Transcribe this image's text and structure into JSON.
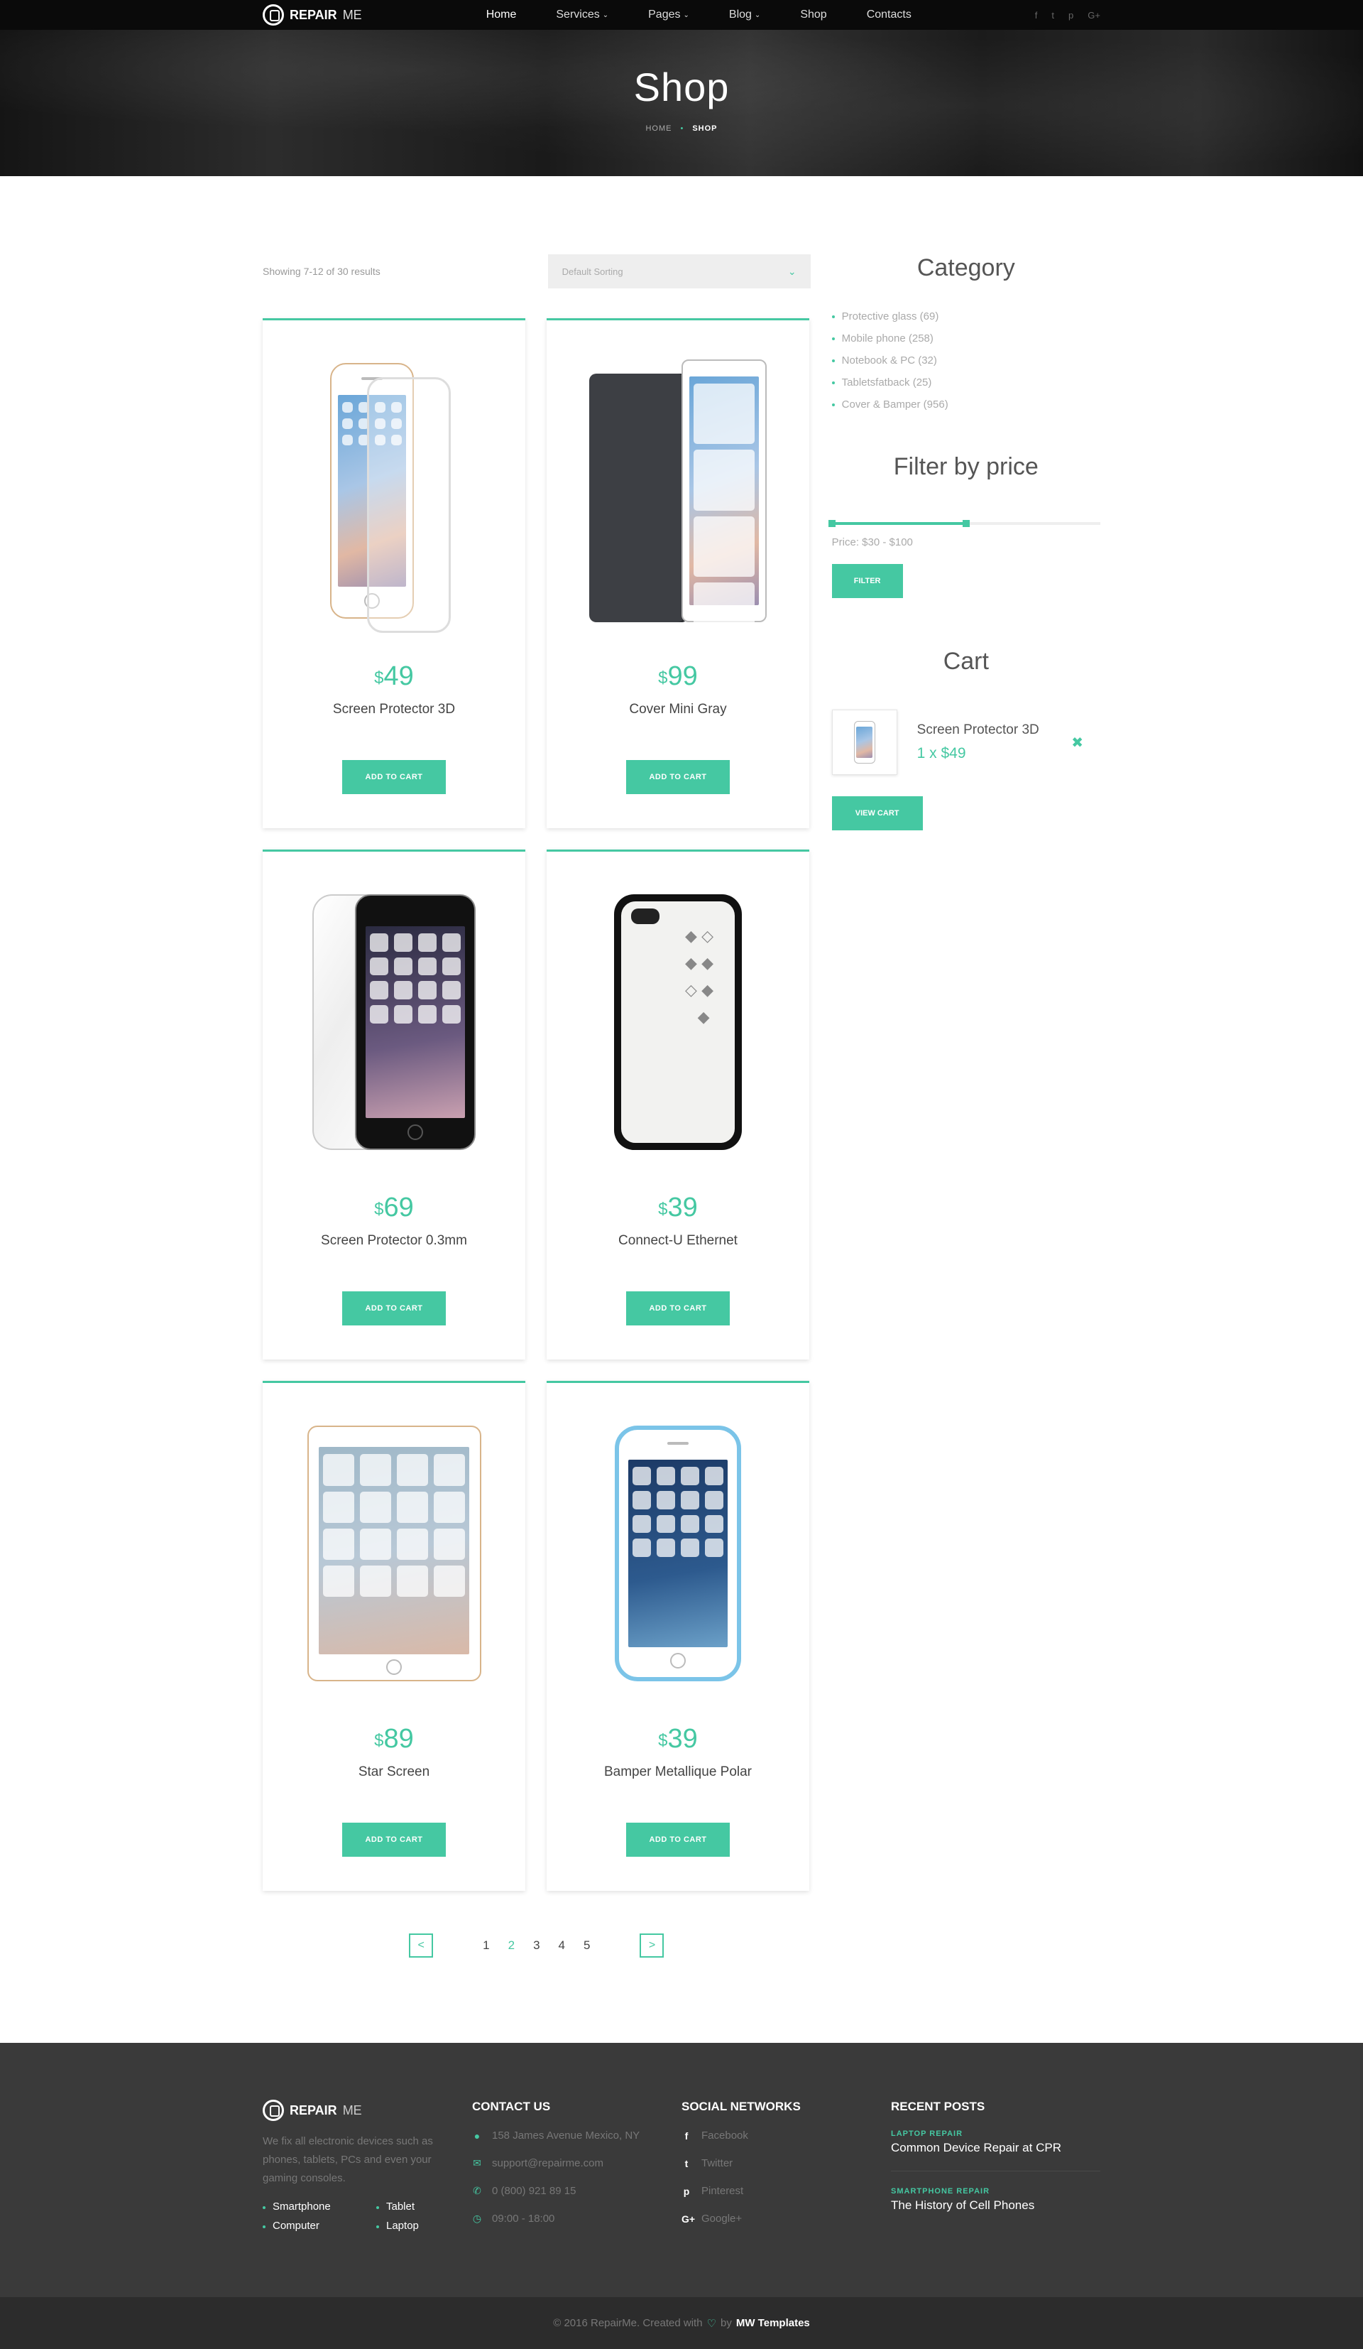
{
  "brand": {
    "bold": "REPAIR",
    "light": "ME"
  },
  "nav": {
    "items": [
      {
        "label": "Home",
        "active": true,
        "caret": false
      },
      {
        "label": "Services",
        "active": false,
        "caret": true
      },
      {
        "label": "Pages",
        "active": false,
        "caret": true
      },
      {
        "label": "Blog",
        "active": false,
        "caret": true
      },
      {
        "label": "Shop",
        "active": false,
        "caret": false
      },
      {
        "label": "Contacts",
        "active": false,
        "caret": false
      }
    ],
    "socials": [
      "f",
      "t",
      "p",
      "G+"
    ]
  },
  "hero": {
    "title": "Shop",
    "breadcrumb_home": "HOME",
    "breadcrumb_current": "SHOP"
  },
  "shop": {
    "results": "Showing 7-12 of 30 results",
    "sorting": "Default Sorting",
    "currency": "$",
    "add_label": "ADD TO CART",
    "products": [
      {
        "price": "49",
        "name": "Screen Protector 3D",
        "icon": "iphone-glass"
      },
      {
        "price": "99",
        "name": "Cover Mini Gray",
        "icon": "ipad-cover"
      },
      {
        "price": "69",
        "name": "Screen Protector 0.3mm",
        "icon": "iphone-screen-protector"
      },
      {
        "price": "39",
        "name": "Connect-U Ethernet",
        "icon": "studded-case"
      },
      {
        "price": "89",
        "name": "Star Screen",
        "icon": "ipad-mini"
      },
      {
        "price": "39",
        "name": "Bamper Metallique Polar",
        "icon": "blue-bumper-iphone"
      }
    ]
  },
  "pagination": {
    "pages": [
      "1",
      "2",
      "3",
      "4",
      "5"
    ],
    "current": "2",
    "prev": "<",
    "next": ">"
  },
  "sidebar": {
    "category_title": "Category",
    "categories": [
      "Protective glass (69)",
      "Mobile phone (258)",
      "Notebook & PC (32)",
      "Tabletsfatback (25)",
      "Cover & Bamper (956)"
    ],
    "filter_title": "Filter by price",
    "price_label": "Price: $30 - $100",
    "slider_range": [
      0.0,
      0.5
    ],
    "filter_button": "FILTER",
    "cart_title": "Cart",
    "cart_item_name": "Screen Protector 3D",
    "cart_item_qty": "1 x $49",
    "view_cart_button": "VIEW CART"
  },
  "footer": {
    "brand_bold": "REPAIR",
    "brand_light": "ME",
    "description": "We fix all electronic devices such as phones, tablets, PCs and even your gaming consoles.",
    "links": [
      "Smartphone",
      "Tablet",
      "Computer",
      "Laptop"
    ],
    "contact_title": "CONTACT US",
    "contact": [
      {
        "icon": "map-pin-icon",
        "glyph": "●",
        "text": "158 James Avenue Mexico, NY"
      },
      {
        "icon": "envelope-icon",
        "glyph": "✉",
        "text": "support@repairme.com"
      },
      {
        "icon": "phone-icon",
        "glyph": "✆",
        "text": "0 (800) 921 89 15"
      },
      {
        "icon": "clock-icon",
        "glyph": "◷",
        "text": "09:00 - 18:00"
      }
    ],
    "social_title": "SOCIAL NETWORKS",
    "social": [
      {
        "icon": "facebook-icon",
        "glyph": "f",
        "text": "Facebook"
      },
      {
        "icon": "twitter-icon",
        "glyph": "t",
        "text": "Twitter"
      },
      {
        "icon": "pinterest-icon",
        "glyph": "p",
        "text": "Pinterest"
      },
      {
        "icon": "googleplus-icon",
        "glyph": "G+",
        "text": "Google+"
      }
    ],
    "posts_title": "RECENT POSTS",
    "posts": [
      {
        "category": "LAPTOP REPAIR",
        "title": "Common Device Repair at CPR"
      },
      {
        "category": "SMARTPHONE REPAIR",
        "title": "The History of Cell Phones"
      }
    ],
    "copyright": "© 2016 RepairMe. Created with",
    "by": "by",
    "author": "MW Templates"
  },
  "colors": {
    "accent": "#45c8a2",
    "dark": "#0a0a0a",
    "footer": "#3a3a3a"
  }
}
